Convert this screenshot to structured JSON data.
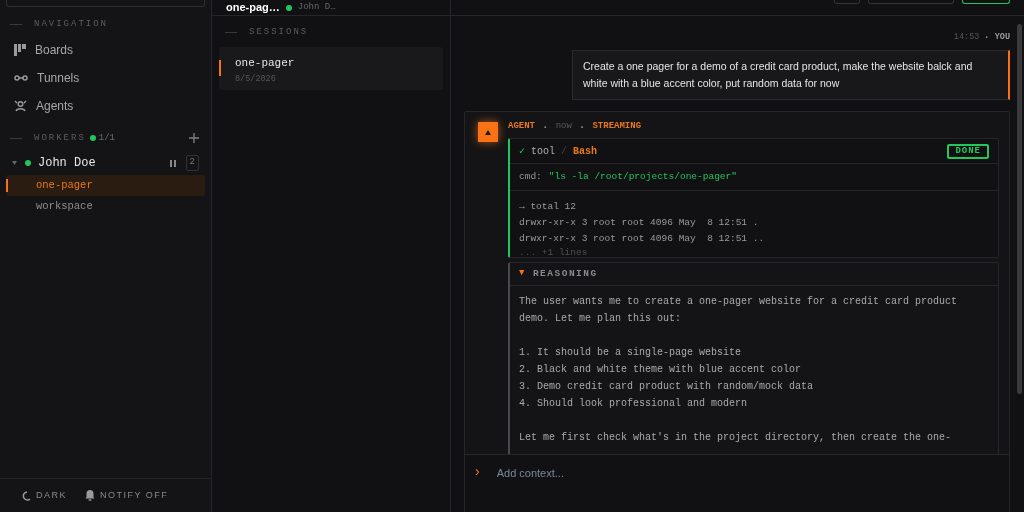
{
  "sidebar": {
    "nav_heading": "NAVIGATION",
    "nav_items": [
      {
        "label": "Boards",
        "kind": "boards"
      },
      {
        "label": "Tunnels",
        "kind": "tunnels"
      },
      {
        "label": "Agents",
        "kind": "agents"
      }
    ],
    "workers_heading": "WORKERS",
    "workers_count": "1/1",
    "workers": [
      {
        "name": "John Doe",
        "online": true,
        "expanded": true,
        "count": "2",
        "sessions": [
          {
            "label": "one-pager",
            "selected": true
          },
          {
            "label": "workspace",
            "selected": false
          }
        ]
      }
    ],
    "footer": [
      {
        "label": "DARK",
        "kind": "theme"
      },
      {
        "label": "NOTIFY OFF",
        "kind": "notify"
      }
    ]
  },
  "sessions_panel": {
    "title": "one-pag…",
    "user": "John D…",
    "online": true,
    "heading": "SESSIONS",
    "items": [
      {
        "title": "one-pager",
        "date": "8/5/2026",
        "selected": true
      }
    ]
  },
  "chat": {
    "user_message": {
      "time": "14:53",
      "author": "YOU",
      "text": "Create a one pager for a demo of a credit card product, make the website balck and white with a blue accent color, put random data for now"
    },
    "agent": {
      "author": "AGENT",
      "time": "now",
      "status": "STREAMING",
      "tool": {
        "check": "✓",
        "label": "tool",
        "separator": "/",
        "name": "Bash",
        "badge": "DONE",
        "cmd_label": "cmd:",
        "cmd_value": "\"ls -la /root/projects/one-pager\"",
        "output": [
          "→ total 12",
          "drwxr-xr-x 3 root root 4096 May  8 12:51 .",
          "drwxr-xr-x 3 root root 4096 May  8 12:51 .."
        ],
        "more": "... +1 lines"
      },
      "reasoning": {
        "arrow": "▼",
        "title": "REASONING",
        "expanded": true,
        "paragraphs": [
          [
            "The user wants me to create a one-pager website for a credit card product",
            "demo. Let me plan this out:"
          ],
          [
            "1. It should be a single-page website",
            "2. Black and white theme with blue accent color",
            "3. Demo credit card product with random/mock data",
            "4. Should look professional and modern"
          ],
          [
            "Let me first check what's in the project directory, then create the one-"
          ]
        ]
      }
    },
    "separator": "·",
    "input": {
      "prompt": "›",
      "placeholder": "Add context..."
    }
  }
}
